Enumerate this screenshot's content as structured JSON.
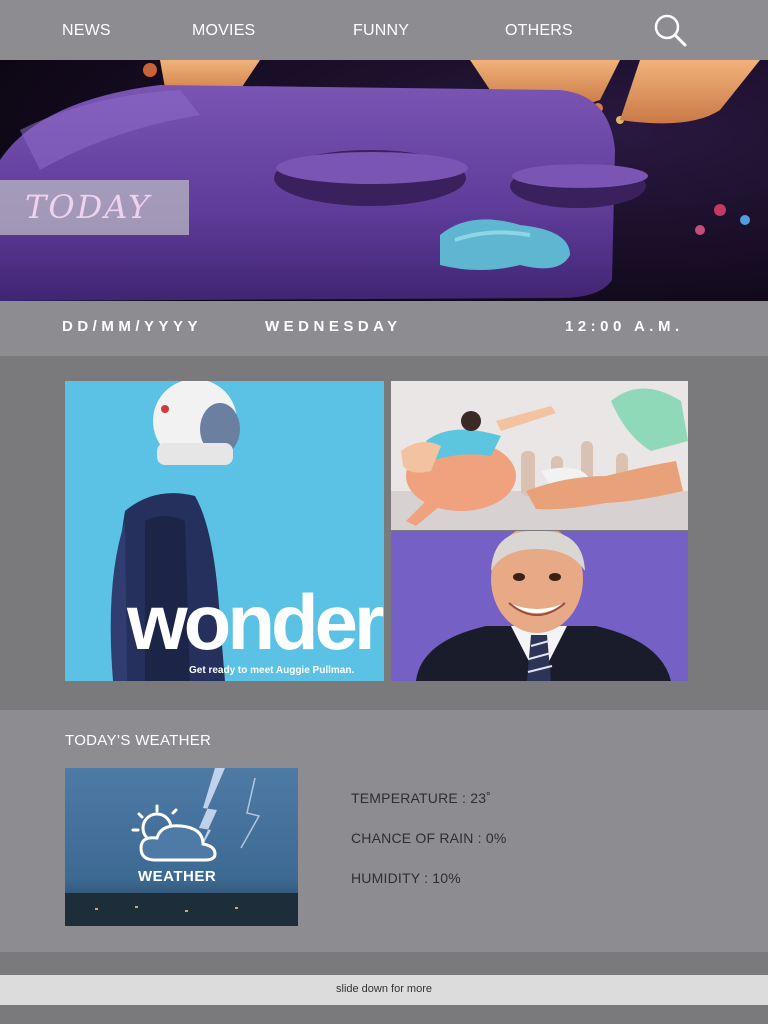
{
  "nav": {
    "items": [
      {
        "label": "NEWS"
      },
      {
        "label": "MOVIES"
      },
      {
        "label": "FUNNY"
      },
      {
        "label": "OTHERS"
      }
    ],
    "search_icon": "search-icon"
  },
  "hero": {
    "tag": "TODAY"
  },
  "datebar": {
    "date": "DD/MM/YYYY",
    "weekday": "WEDNESDAY",
    "time": "12:00 A.M."
  },
  "gallery": {
    "poster": {
      "title": "wonder",
      "tagline": "Get ready to meet Auggie Pullman."
    }
  },
  "weather": {
    "heading": "TODAY’S WEATHER",
    "image_label": "WEATHER",
    "icon": "sun-cloud-icon",
    "stats": {
      "temperature": "TEMPERATURE : 23˚",
      "rain": "CHANCE OF RAIN : 0%",
      "humidity": "HUMIDITY : 10%"
    }
  },
  "footer": {
    "hint": "slide down for more"
  },
  "colors": {
    "bar": "#8d8c90",
    "page": "#7a797b",
    "footer": "#dcdcdc",
    "today_text": "#eed3ef"
  }
}
